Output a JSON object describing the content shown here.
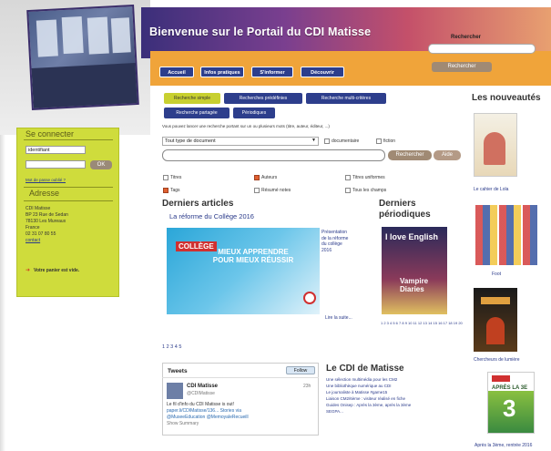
{
  "header": {
    "title": "Bienvenue sur le Portail du CDI Matisse",
    "search_label": "Rechercher",
    "search_button": "Rechercher",
    "nav": [
      "Accueil",
      "Infos pratiques",
      "S'informer",
      "Découvrir"
    ]
  },
  "login": {
    "title": "Se connecter",
    "id_value": "identifiant",
    "ok": "OK",
    "forgot": "Mot de passe oublié ?"
  },
  "address": {
    "title": "Adresse",
    "lines": [
      "CDI Matisse",
      "BP 23 Rue de Sedan",
      "78130 Les Mureaux",
      "France",
      "02 31 07 80 55"
    ],
    "contact": "contact"
  },
  "cart": "Votre panier est vide.",
  "search": {
    "tabs": [
      "Recherche simple",
      "Recherches prédéfinies",
      "Recherche multi-critères"
    ],
    "tabs2": [
      "Recherche partagée",
      "Périodiques"
    ],
    "instructions": "Vous pouvez lancer une recherche portant sur un ou plusieurs mots (titre, auteur, éditeur, ...)",
    "doctype": "Tout type de document",
    "doc_label": "documentaire",
    "fiction_label": "fiction",
    "button": "Rechercher",
    "help": "Aide",
    "criteria": [
      "Titres",
      "Auteurs",
      "Titres uniformes",
      "Tags",
      "Résumé notes",
      "Tous les champs"
    ]
  },
  "articles": {
    "title": "Derniers articles",
    "link": "La réforme du Collège 2016",
    "image_text_1": "COLLÈGE",
    "image_text_2": "MIEUX APPRENDRE POUR MIEUX RÉUSSIR",
    "side_text": "Présentation de la réforme du collège 2016",
    "read_more": "Lire la suite...",
    "pages": "1 2 3 4 5"
  },
  "periodicals": {
    "title": "Derniers périodiques",
    "cover_title": "I love English",
    "cover_sub": "Vampire Diaries",
    "pages": "1 2 3 4 5 6 7 8 9 10 11 12 13 14 15 16 17 18 19 20"
  },
  "tweets": {
    "title": "Tweets",
    "follow": "Follow",
    "name": "CDI Matisse",
    "handle": "@CDIMatisse",
    "time": "23h",
    "text_1": "Le fil d'info du CDI Matisse is out!",
    "text_2": "paper.li/CDIMatisse/136... Stories via",
    "text_3": "@MuseeEducation @MemoyaleRecueill",
    "summary": "Show Summary"
  },
  "cdi": {
    "title": "Le CDI de Matisse",
    "items": [
      "Une sélection multimédia pour les CM2",
      "Une bibliothèque numérique au CDI",
      "Le journaliste à Matisse #game15",
      "Liaison CM2/6ème : visiteur réalisé en fiche",
      "Guides Onisep : Après la 3ème, après la 3ème",
      "SEGPA..."
    ]
  },
  "new_books": {
    "title": "Les nouveautés",
    "captions": [
      "Le cahier de Lola",
      "Foot",
      "Chercheurs de lumière",
      "Après la 3ème, rentrée 2016"
    ],
    "cover_3": "APRÈS LA 3E"
  }
}
